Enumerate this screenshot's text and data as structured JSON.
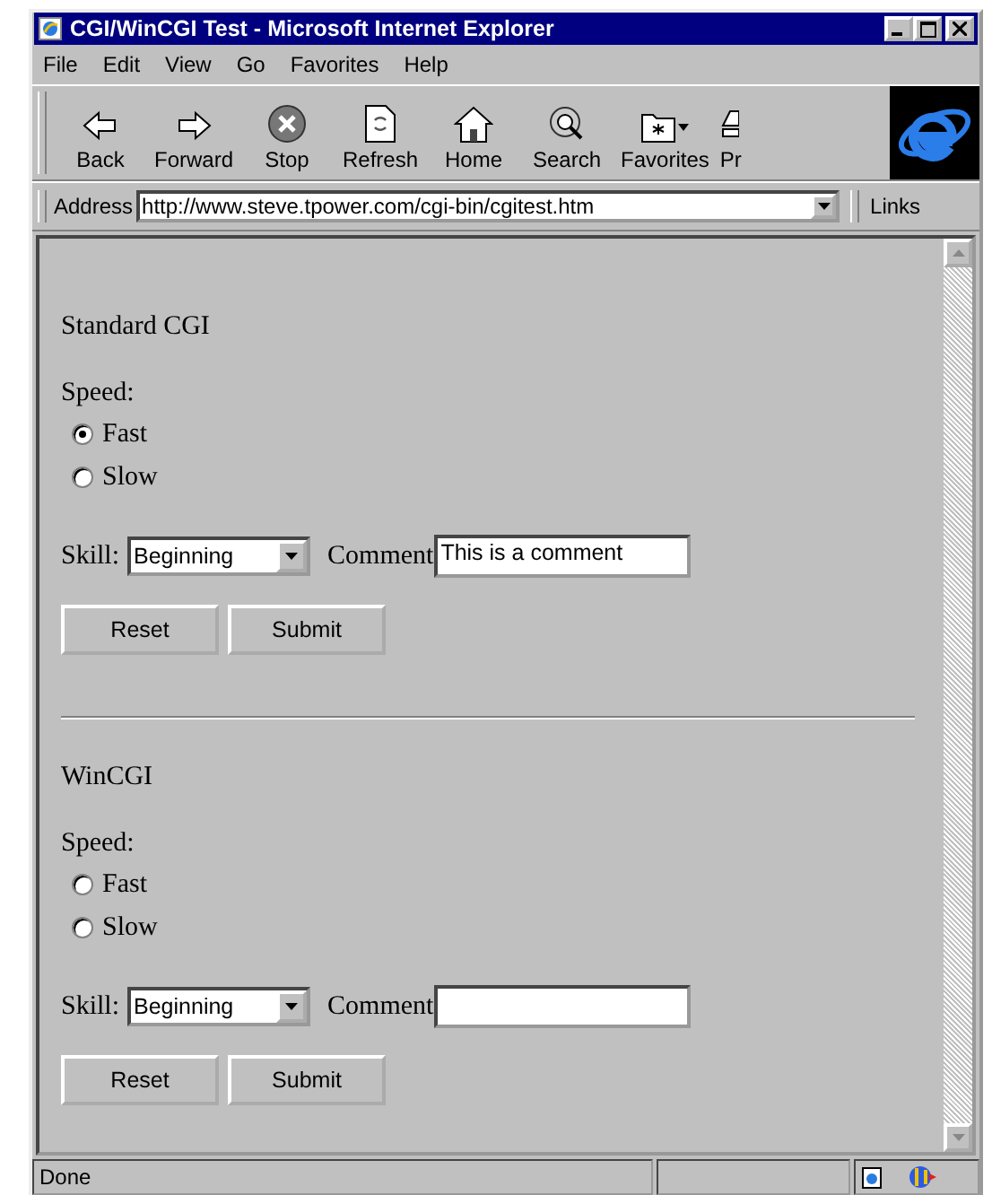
{
  "window": {
    "title": "CGI/WinCGI Test - Microsoft Internet Explorer"
  },
  "menu": [
    "File",
    "Edit",
    "View",
    "Go",
    "Favorites",
    "Help"
  ],
  "toolbar": [
    {
      "kind": "back",
      "label": "Back"
    },
    {
      "kind": "forward",
      "label": "Forward"
    },
    {
      "kind": "stop",
      "label": "Stop"
    },
    {
      "kind": "refresh",
      "label": "Refresh"
    },
    {
      "kind": "home",
      "label": "Home"
    },
    {
      "kind": "search",
      "label": "Search"
    },
    {
      "kind": "favorites",
      "label": "Favorites"
    },
    {
      "kind": "print",
      "label": "Pr"
    }
  ],
  "address": {
    "label": "Address",
    "value": "http://www.steve.tpower.com/cgi-bin/cgitest.htm",
    "links": "Links"
  },
  "forms": [
    {
      "title": "Standard CGI",
      "speed_label": "Speed:",
      "options": [
        {
          "label": "Fast",
          "selected": true
        },
        {
          "label": "Slow",
          "selected": false
        }
      ],
      "skill_label": "Skill:",
      "skill_value": "Beginning",
      "comment_label": "Comment",
      "comment_value": "This is a comment",
      "buttons": [
        "Reset",
        "Submit"
      ]
    },
    {
      "title": "WinCGI",
      "speed_label": "Speed:",
      "options": [
        {
          "label": "Fast",
          "selected": false
        },
        {
          "label": "Slow",
          "selected": false
        }
      ],
      "skill_label": "Skill:",
      "skill_value": "Beginning",
      "comment_label": "Comment",
      "buttons": [
        "Reset",
        "Submit"
      ]
    }
  ],
  "status_bar": {
    "text": "Done"
  }
}
